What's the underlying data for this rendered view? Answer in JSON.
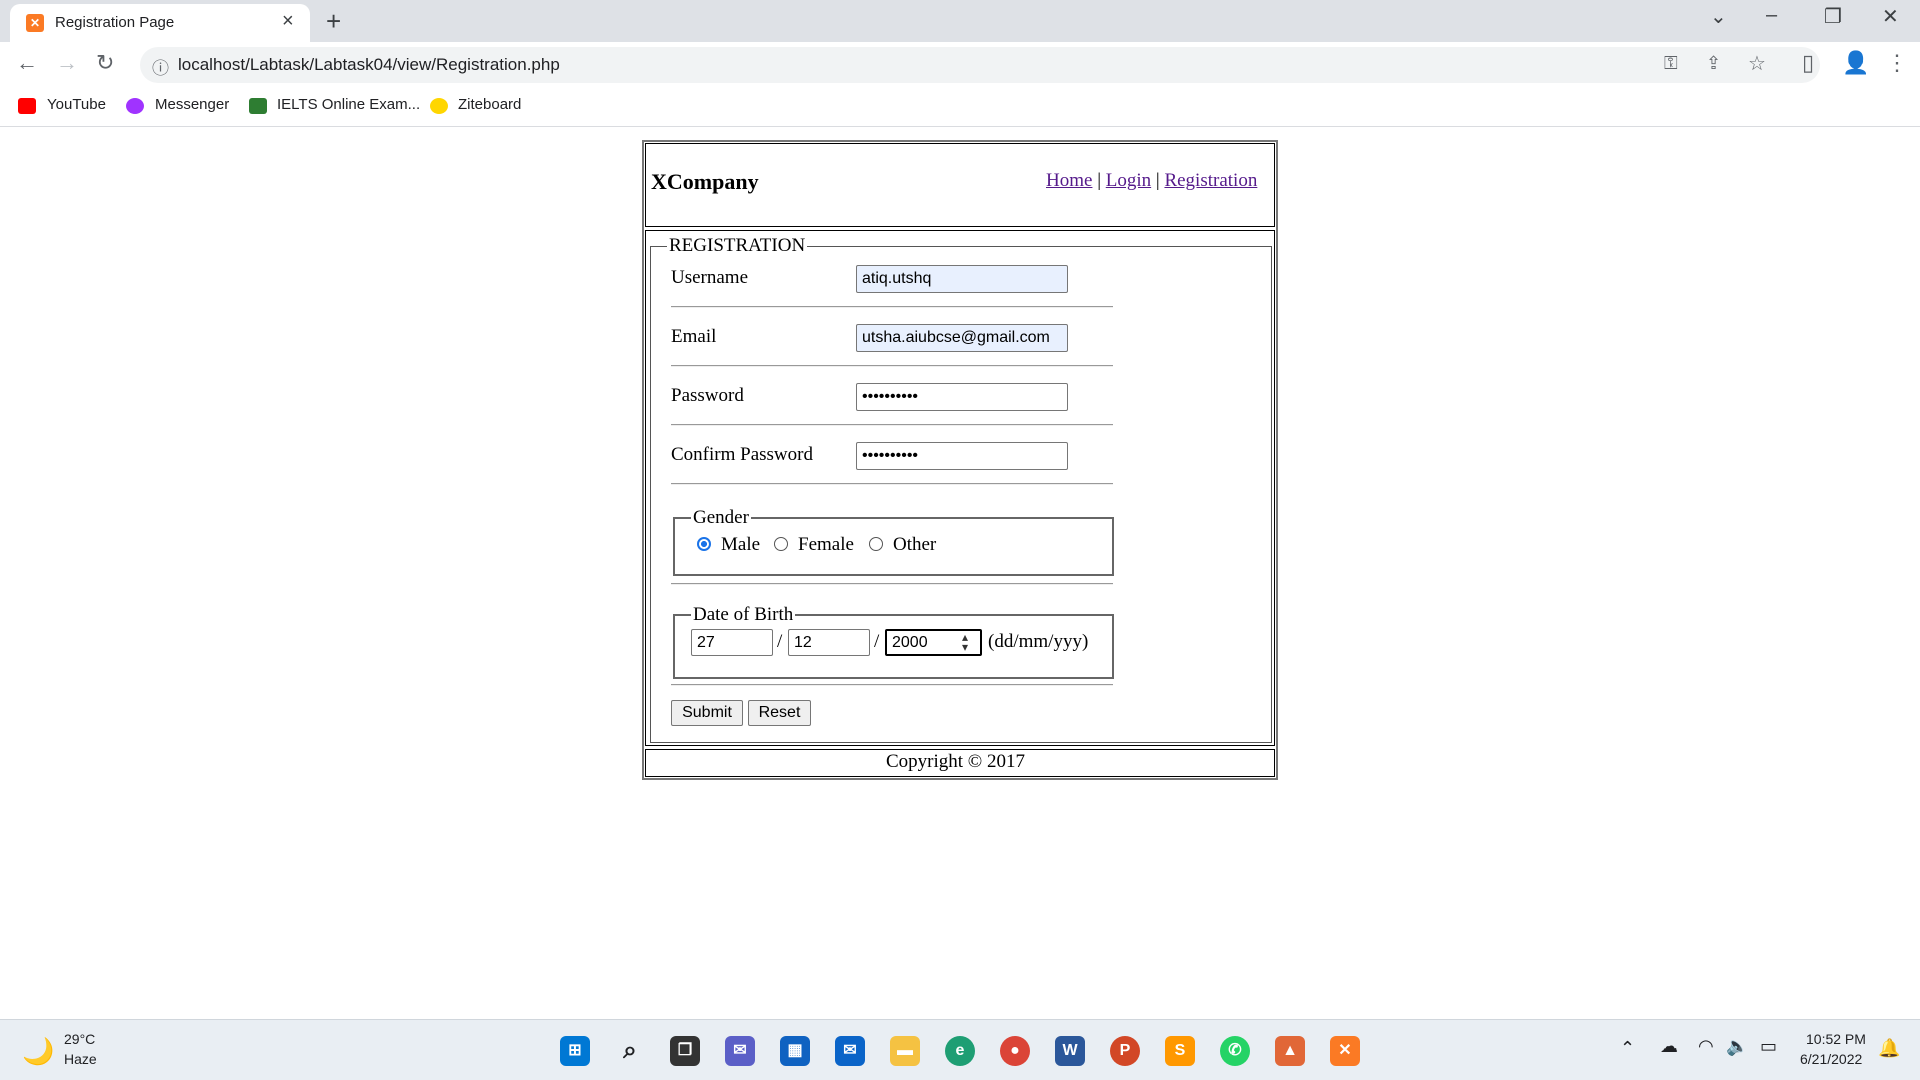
{
  "browser": {
    "tab_title": "Registration Page",
    "url": "localhost/Labtask/Labtask04/view/Registration.php",
    "bookmarks": [
      {
        "label": "YouTube",
        "icon": "youtube-icon",
        "color": "#ff0000"
      },
      {
        "label": "Messenger",
        "icon": "messenger-icon",
        "color": "#a033ff"
      },
      {
        "label": "IELTS Online Exam...",
        "icon": "ielts-icon",
        "color": "#2e7d32"
      },
      {
        "label": "Ziteboard",
        "icon": "ziteboard-icon",
        "color": "#ffd600"
      }
    ]
  },
  "site": {
    "brand": "XCompany",
    "nav": {
      "home": "Home",
      "login": "Login",
      "registration": "Registration",
      "sep": "|"
    },
    "footer": "Copyright © 2017"
  },
  "form": {
    "legend": "REGISTRATION",
    "username_label": "Username",
    "username_value": "atiq.utshq",
    "email_label": "Email",
    "email_value": "utsha.aiubcse@gmail.com",
    "password_label": "Password",
    "password_value": "••••••••••",
    "confirm_label": "Confirm Password",
    "confirm_value": "••••••••••",
    "gender_legend": "Gender",
    "gender_options": [
      "Male",
      "Female",
      "Other"
    ],
    "gender_selected": "Male",
    "dob_legend": "Date of Birth",
    "dob_day": "27",
    "dob_month": "12",
    "dob_year": "2000",
    "dob_sep": "/",
    "dob_hint": "(dd/mm/yyy)",
    "submit_label": "Submit",
    "reset_label": "Reset"
  },
  "taskbar": {
    "weather_temp": "29°C",
    "weather_desc": "Haze",
    "time": "10:52 PM",
    "date": "6/21/2022"
  }
}
